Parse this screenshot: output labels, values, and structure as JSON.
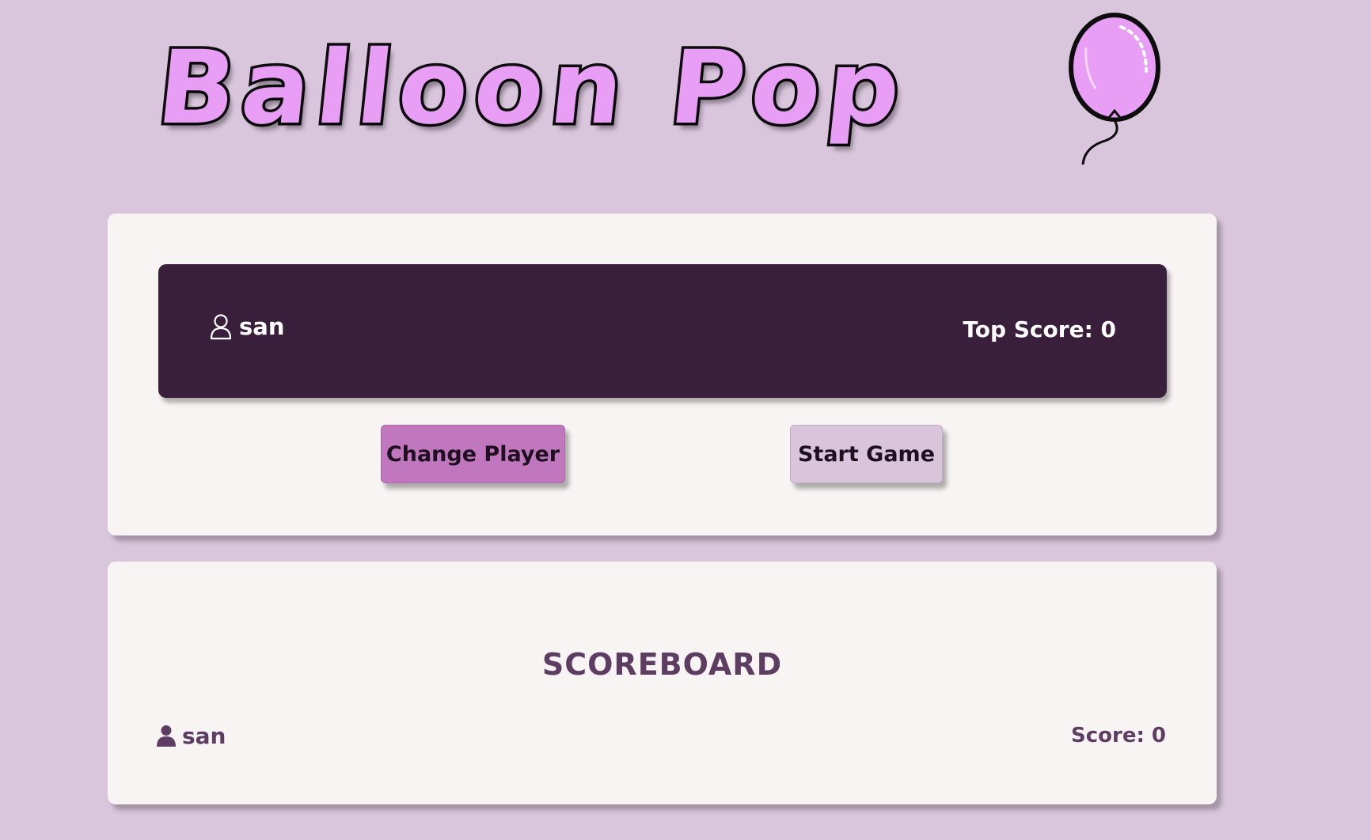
{
  "app": {
    "title": "Balloon Pop"
  },
  "player": {
    "name": "san",
    "top_score_label": "Top Score: 0"
  },
  "buttons": {
    "change_player": "Change Player",
    "start_game": "Start Game"
  },
  "scoreboard": {
    "title": "SCOREBOARD",
    "entries": [
      {
        "name": "san",
        "score_label": "Score: 0"
      }
    ]
  },
  "colors": {
    "background": "#d9c5dc",
    "card": "#f8f4f4",
    "player_bar": "#3a1f3d",
    "title_fill": "#e89ef5",
    "change_button": "#c177bd",
    "start_button": "#d9c4dc",
    "scoreboard_text": "#5e3d63"
  },
  "icons": {
    "title_decoration": "balloon-icon",
    "player": "user-outline-icon",
    "scoreboard_player": "user-solid-icon"
  }
}
